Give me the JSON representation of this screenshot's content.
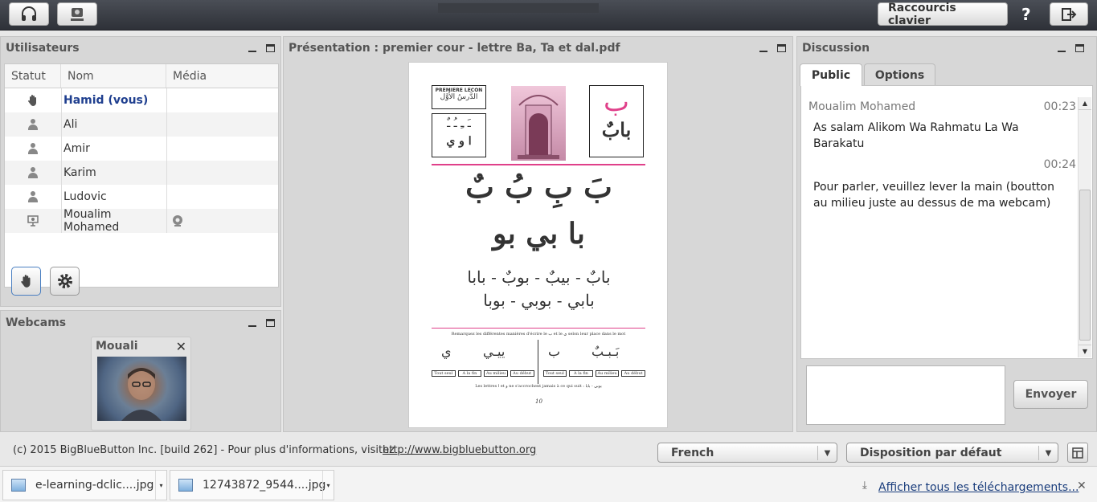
{
  "toolbar": {
    "shortcuts_label": "Raccourcis clavier",
    "help_label": "?"
  },
  "users_panel": {
    "title": "Utilisateurs",
    "columns": [
      "Statut",
      "Nom",
      "Média"
    ],
    "rows": [
      {
        "name": "Hamid (vous)",
        "status_icon": "raised-hand-icon",
        "media_icon": ""
      },
      {
        "name": "Ali",
        "status_icon": "user-icon",
        "media_icon": ""
      },
      {
        "name": "Amir",
        "status_icon": "user-icon",
        "media_icon": ""
      },
      {
        "name": "Karim",
        "status_icon": "user-icon",
        "media_icon": ""
      },
      {
        "name": "Ludovic",
        "status_icon": "user-icon",
        "media_icon": ""
      },
      {
        "name": "Moualim Mohamed",
        "status_icon": "presenter-icon",
        "media_icon": "webcam-icon"
      }
    ]
  },
  "webcams_panel": {
    "title": "Webcams",
    "cam_name": "Mouali"
  },
  "presentation_panel": {
    "title": "Présentation : premier cour - lettre Ba, Ta et dal.pdf",
    "slide": {
      "lesson_label": "PREMIERE LECON",
      "lesson_label_ar": "الدَّرسُ الأَوَّل",
      "vowels_line1": "ـَ ـِ ـُ ـٌ",
      "vowels_line2": "ا و ي",
      "big_letter": "ب",
      "big_word": "بابٌ",
      "row1": "بَ بِ بُ بٌ",
      "row2": "با بي بو",
      "row3": "بابٌ - بيبٌ - بوبٌ - بابا",
      "row4": "بابي - بوبي - بوبا",
      "note": "Remarquez les différentes manières d'écrire le ب et le ي selon leur place dans le mot",
      "tables": {
        "left_letter": "ي",
        "left_forms": "ييـي",
        "right_letter": "ب",
        "right_forms": "بَـبـبٌ",
        "labels": [
          "Tout seul",
          "A la fin",
          "Au milieu",
          "Au début"
        ]
      },
      "footer_note": "Les lettres ا et و ne s'accrochent jamais à ce qui suit : بوبي - بابا",
      "page_number": "10"
    }
  },
  "discussion_panel": {
    "title": "Discussion",
    "tabs": [
      "Public",
      "Options"
    ],
    "messages": [
      {
        "sender": "Moualim Mohamed",
        "time": "00:23",
        "text": "As salam Alikom Wa Rahmatu La Wa Barakatu"
      },
      {
        "sender": "",
        "time": "00:24",
        "text": "Pour parler, veuillez lever la main (boutton au milieu juste au dessus de ma webcam)"
      }
    ],
    "send_label": "Envoyer"
  },
  "footer": {
    "copyright": "(c) 2015 BigBlueButton Inc. [build 262] - Pour plus d'informations, visitez",
    "link": "http://www.bigbluebutton.org",
    "language": "French",
    "layout": "Disposition par défaut"
  },
  "downloads": {
    "items": [
      "e-learning-dclic....jpg",
      "12743872_9544....jpg"
    ],
    "show_all": "Afficher tous les téléchargements..."
  },
  "colors": {
    "accent_pink": "#e0408a",
    "user_self": "#1f3f8f"
  }
}
